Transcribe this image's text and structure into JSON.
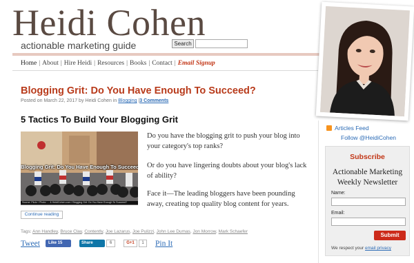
{
  "header": {
    "site_title": "Heidi Cohen",
    "tagline": "actionable marketing guide",
    "search_button": "Search",
    "search_placeholder": ""
  },
  "nav": {
    "items": [
      "Home",
      "About",
      "Hire Heidi",
      "Resources",
      "Books",
      "Contact"
    ],
    "signup": "Email Signup",
    "separator": "|"
  },
  "post": {
    "title": "Blogging Grit: Do You Have Enough To Succeed?",
    "meta_prefix": "Posted on March 22, 2017 by Heidi Cohen in",
    "category": "Blogging",
    "meta_sep": "|",
    "comments": "3 Comments",
    "subheading": "5 Tactics To Build Your Blogging Grit",
    "image_title": "Blogging Grit: Do You Have Enough To Succeed?",
    "image_credit": "Source: Flickr / Photo: ... & HeidiCohen.com / Blogging Grit: Do You Have Enough To Succeed?",
    "paragraphs": [
      "Do you have the blogging grit to push your blog into your category's top ranks?",
      "Or do you have lingering doubts about your blog's lack of ability?",
      "Face it—The leading bloggers have been pounding away, creating top quality blog content for years."
    ],
    "continue_label": "Continue reading",
    "tags_label": "Tags:",
    "tags": [
      "Ann Handley",
      "Bruce Clay",
      "Contently",
      "Joe Lazarus",
      "Joe Pulizzi",
      "John Lee Dumas",
      "Jon Morrow",
      "Mark Schaefer"
    ]
  },
  "share": {
    "tweet": "Tweet",
    "fb_label": "Like 15",
    "in_label": "Share",
    "in_count": "6",
    "gplus_label": "G+1",
    "gplus_count": "1",
    "pin": "Pin It"
  },
  "sidebar": {
    "rss": "Articles Feed",
    "follow": "Follow @HeidiCohen",
    "newsletter": {
      "title": "Subscribe",
      "subtitle_line1": "Actionable Marketing",
      "subtitle_line2": "Weekly Newsletter",
      "name_label": "Name:",
      "email_label": "Email:",
      "submit": "Submit",
      "privacy_prefix": "We respect your",
      "privacy_link": "email privacy"
    }
  },
  "colors": {
    "accent": "#b83a1a",
    "link": "#2a6ab5",
    "header_rule": "#e7c9c0",
    "title_brown": "#5a4a42"
  }
}
